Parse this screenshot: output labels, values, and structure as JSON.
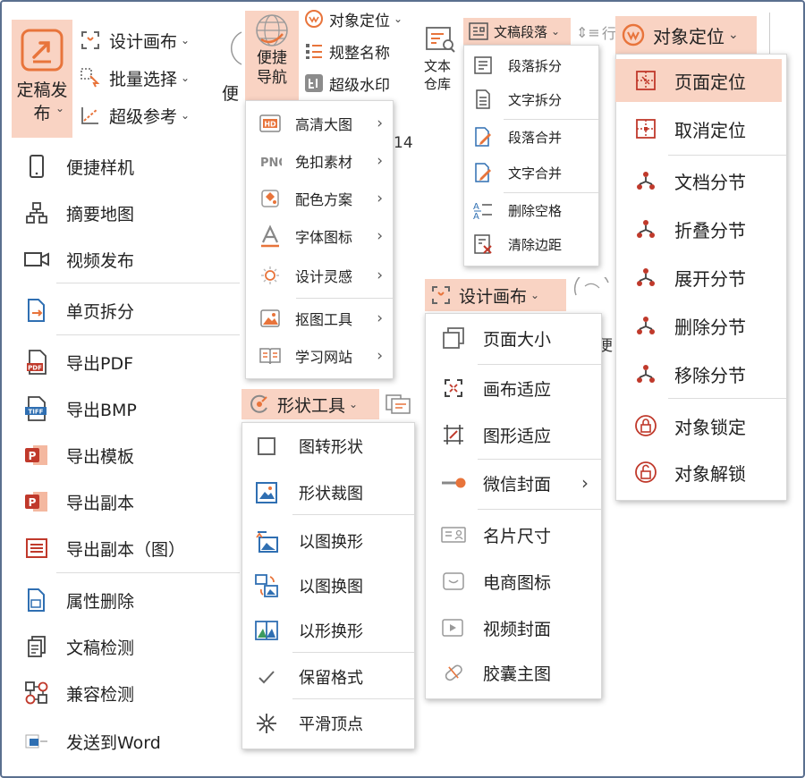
{
  "ribbon": {
    "publish_label": "定稿发布",
    "design_canvas": "设计画布",
    "batch_select": "批量选择",
    "super_ref": "超级参考",
    "partial_next": "便",
    "quick_nav": "便捷导航",
    "object_position": "对象定位",
    "normalize_name": "规整名称",
    "super_watermark": "超级水印",
    "text_warehouse": "文本仓库",
    "doc_paragraph": "文稿段落",
    "partial_line": "行",
    "design_canvas2": "设计画布",
    "shape_tool": "形状工具",
    "object_position2": "对象定位",
    "partial_value": "14",
    "partial_char": "便"
  },
  "publish_menu": {
    "items": [
      {
        "label": "便捷样机",
        "icon": "phone-icon"
      },
      {
        "label": "摘要地图",
        "icon": "sitemap-icon"
      },
      {
        "label": "视频发布",
        "icon": "video-camera-icon"
      },
      {
        "label": "单页拆分",
        "icon": "page-split-icon"
      },
      {
        "label": "导出PDF",
        "icon": "pdf-file-icon"
      },
      {
        "label": "导出BMP",
        "icon": "tiff-file-icon"
      },
      {
        "label": "导出模板",
        "icon": "powerpoint-icon"
      },
      {
        "label": "导出副本",
        "icon": "powerpoint-copy-icon"
      },
      {
        "label": "导出副本（图）",
        "icon": "list-lines-icon"
      },
      {
        "label": "属性删除",
        "icon": "document-delete-icon"
      },
      {
        "label": "文稿检测",
        "icon": "documents-check-icon"
      },
      {
        "label": "兼容检测",
        "icon": "compatibility-icon"
      },
      {
        "label": "发送到Word",
        "icon": "send-word-icon"
      }
    ]
  },
  "nav_menu": {
    "items": [
      {
        "label": "高清大图",
        "icon": "hd-icon"
      },
      {
        "label": "免扣素材",
        "icon": "png-icon"
      },
      {
        "label": "配色方案",
        "icon": "paint-bucket-icon"
      },
      {
        "label": "字体图标",
        "icon": "font-a-icon"
      },
      {
        "label": "设计灵感",
        "icon": "lightbulb-icon"
      },
      {
        "label": "抠图工具",
        "icon": "image-cutout-icon"
      },
      {
        "label": "学习网站",
        "icon": "open-book-icon"
      }
    ]
  },
  "shape_menu": {
    "items": [
      {
        "label": "图转形状",
        "icon": "square-outline-icon"
      },
      {
        "label": "形状裁图",
        "icon": "image-crop-icon"
      },
      {
        "label": "以图换形",
        "icon": "image-swap-shape-icon"
      },
      {
        "label": "以图换图",
        "icon": "image-swap-image-icon"
      },
      {
        "label": "以形换形",
        "icon": "shape-swap-icon"
      },
      {
        "label": "保留格式",
        "icon": "checkmark-icon"
      },
      {
        "label": "平滑顶点",
        "icon": "snowflake-icon"
      }
    ]
  },
  "paragraph_menu": {
    "items": [
      {
        "label": "段落拆分",
        "icon": "paragraph-split-icon"
      },
      {
        "label": "文字拆分",
        "icon": "text-split-icon"
      },
      {
        "label": "段落合并",
        "icon": "paragraph-merge-icon"
      },
      {
        "label": "文字合并",
        "icon": "text-merge-icon"
      },
      {
        "label": "删除空格",
        "icon": "delete-space-icon"
      },
      {
        "label": "清除边距",
        "icon": "clear-margin-icon"
      }
    ]
  },
  "canvas_menu": {
    "items": [
      {
        "label": "页面大小",
        "icon": "page-size-icon"
      },
      {
        "label": "画布适应",
        "icon": "canvas-fit-icon"
      },
      {
        "label": "图形适应",
        "icon": "shape-fit-icon"
      },
      {
        "label": "微信封面",
        "icon": "wechat-cover-icon"
      },
      {
        "label": "名片尺寸",
        "icon": "business-card-icon"
      },
      {
        "label": "电商图标",
        "icon": "ecommerce-icon"
      },
      {
        "label": "视频封面",
        "icon": "video-cover-icon"
      },
      {
        "label": "胶囊主图",
        "icon": "capsule-icon"
      }
    ]
  },
  "position_menu": {
    "items": [
      {
        "label": "页面定位",
        "icon": "page-position-icon"
      },
      {
        "label": "取消定位",
        "icon": "cancel-position-icon"
      },
      {
        "label": "文档分节",
        "icon": "section-icon"
      },
      {
        "label": "折叠分节",
        "icon": "section-collapse-icon"
      },
      {
        "label": "展开分节",
        "icon": "section-expand-icon"
      },
      {
        "label": "删除分节",
        "icon": "section-delete-icon"
      },
      {
        "label": "移除分节",
        "icon": "section-remove-icon"
      },
      {
        "label": "对象锁定",
        "icon": "lock-icon"
      },
      {
        "label": "对象解锁",
        "icon": "unlock-icon"
      }
    ]
  },
  "colors": {
    "accent": "#e8743b",
    "highlight": "#f9d3c3",
    "icon_gray": "#555555",
    "icon_blue": "#2f6fb2",
    "icon_red": "#c0392b"
  }
}
